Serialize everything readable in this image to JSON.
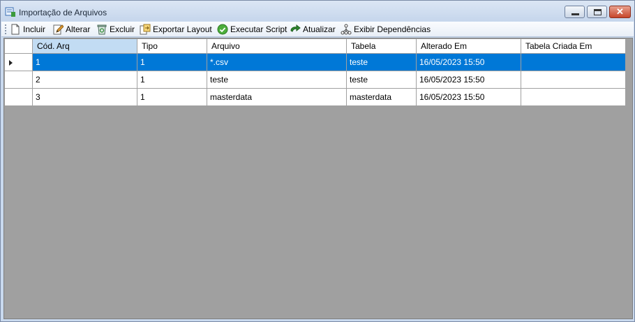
{
  "window": {
    "title": "Importação de Arquivos",
    "close_glyph": "✕"
  },
  "toolbar": {
    "items": [
      {
        "label": "Incluir",
        "icon": "new-document-icon"
      },
      {
        "label": "Alterar",
        "icon": "edit-pencil-icon"
      },
      {
        "label": "Excluir",
        "icon": "delete-recycle-icon"
      },
      {
        "label": "Exportar Layout",
        "icon": "export-layout-icon"
      },
      {
        "label": "Executar Script",
        "icon": "execute-check-icon"
      },
      {
        "label": "Atualizar",
        "icon": "refresh-arrow-icon"
      },
      {
        "label": "Exibir Dependências",
        "icon": "dependencies-tree-icon"
      }
    ]
  },
  "grid": {
    "columns": [
      "Cód. Arq",
      "Tipo",
      "Arquivo",
      "Tabela",
      "Alterado Em",
      "Tabela Criada Em"
    ],
    "selected_row": 0,
    "rows": [
      {
        "cod": "1",
        "tipo": "1",
        "arquivo": "*.csv",
        "tabela": "teste",
        "alterado": "16/05/2023 15:50",
        "criada": ""
      },
      {
        "cod": "2",
        "tipo": "1",
        "arquivo": "teste",
        "tabela": "teste",
        "alterado": "16/05/2023 15:50",
        "criada": ""
      },
      {
        "cod": "3",
        "tipo": "1",
        "arquivo": "masterdata",
        "tabela": "masterdata",
        "alterado": "16/05/2023 15:50",
        "criada": ""
      }
    ]
  },
  "colors": {
    "selection": "#0078d7",
    "client_background": "#a0a0a0",
    "header_highlight": "#c2dcf3"
  }
}
